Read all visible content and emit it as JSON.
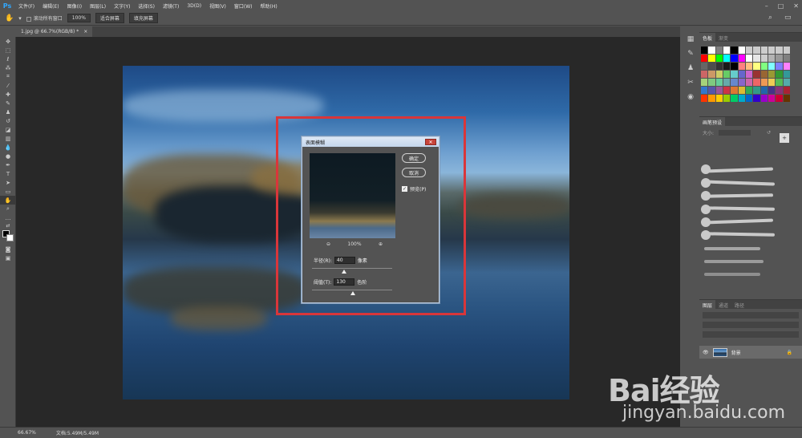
{
  "app": {
    "logo": "Ps"
  },
  "menu": [
    "文件(F)",
    "编辑(E)",
    "图像(I)",
    "图层(L)",
    "文字(Y)",
    "选择(S)",
    "滤镜(T)",
    "3D(D)",
    "视图(V)",
    "窗口(W)",
    "帮助(H)"
  ],
  "options": {
    "scroll_all": "滚动所有窗口",
    "zoom": "100%",
    "fit_screen": "适合屏幕",
    "fill_screen": "填充屏幕"
  },
  "document": {
    "tab_title": "1.jpg @ 66.7%(RGB/8) *",
    "close": "×"
  },
  "dialog": {
    "title": "表面模糊",
    "ok": "确定",
    "cancel": "取消",
    "preview_label": "预览(P)",
    "preview_checked": true,
    "zoom_level": "100%",
    "radius_label": "半径(R):",
    "radius_value": "40",
    "radius_unit": "像素",
    "threshold_label": "阈值(T):",
    "threshold_value": "130",
    "threshold_unit": "色阶"
  },
  "panels": {
    "swatch_tabs": [
      "色板",
      "渐变"
    ],
    "brush_tab": "画笔预设",
    "brush_size_label": "大小:",
    "layer_tabs": [
      "图层",
      "通道",
      "路径"
    ],
    "layer_name": "背景"
  },
  "swatch_colors": [
    "#000000",
    "#ffffff",
    "#7f7f7f",
    "#ffffff",
    "#000000",
    "#ffffff",
    "#cccccc",
    "#cccccc",
    "#cccccc",
    "#cccccc",
    "#cccccc",
    "#cccccc",
    "#ff0000",
    "#ffff00",
    "#00ff00",
    "#00ffff",
    "#0000ff",
    "#ff00ff",
    "#ffffff",
    "#e6e6e6",
    "#cccccc",
    "#b3b3b3",
    "#999999",
    "#808080",
    "#666666",
    "#4d4d4d",
    "#333333",
    "#1a1a1a",
    "#000000",
    "#ff8080",
    "#ffbf80",
    "#ffff80",
    "#80ff80",
    "#80ffff",
    "#8080ff",
    "#ff80ff",
    "#cc6666",
    "#cc9966",
    "#cccc66",
    "#66cc66",
    "#66cccc",
    "#6666cc",
    "#cc66cc",
    "#993333",
    "#996633",
    "#999933",
    "#339933",
    "#339999",
    "#a6d27a",
    "#7fc97f",
    "#66cc99",
    "#66aaaa",
    "#6688cc",
    "#8866cc",
    "#cc66aa",
    "#ee6666",
    "#ee9955",
    "#eecc55",
    "#55bb55",
    "#55aaaa",
    "#3377cc",
    "#5555aa",
    "#995599",
    "#cc3344",
    "#dd7733",
    "#ddbb33",
    "#33aa55",
    "#339988",
    "#2266aa",
    "#443388",
    "#883377",
    "#aa2233",
    "#ff3300",
    "#ff9900",
    "#ffcc00",
    "#99cc00",
    "#00cc66",
    "#00aacc",
    "#0066cc",
    "#3300cc",
    "#9900cc",
    "#cc0099",
    "#cc0033",
    "#663300"
  ],
  "status": {
    "zoom": "66.67%",
    "doc_size": "文档:5.49M/5.49M"
  },
  "watermark": {
    "brand": "Bai经验",
    "url": "jingyan.baidu.com"
  }
}
